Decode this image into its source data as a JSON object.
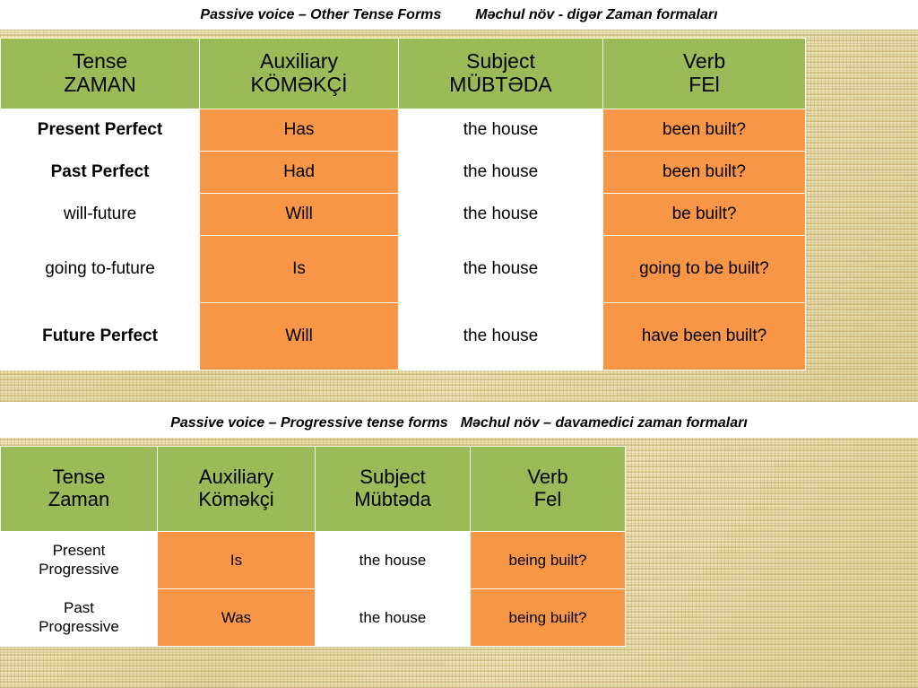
{
  "slide": {
    "section1": {
      "caption_en": "Passive voice – Other Tense Forms",
      "caption_az": "Məchul növ - digər Zaman formaları",
      "headers": [
        {
          "en": "Tense",
          "az": "ZAMAN"
        },
        {
          "en": "Auxiliary",
          "az": "KÖMƏKÇİ"
        },
        {
          "en": "Subject",
          "az": "MÜBTƏDA"
        },
        {
          "en": "Verb",
          "az": "FEl"
        }
      ],
      "rows": [
        {
          "tense": "Present Perfect",
          "aux": "Has",
          "subject": "the house",
          "verb": "been built?"
        },
        {
          "tense": "Past Perfect",
          "aux": "Had",
          "subject": "the house",
          "verb": "been built?"
        },
        {
          "tense": "will-future",
          "aux": "Will",
          "subject": "the house",
          "verb": "be built?"
        },
        {
          "tense": "going to-future",
          "aux": "Is",
          "subject": "the house",
          "verb": "going to be built?"
        },
        {
          "tense": "Future Perfect",
          "aux": "Will",
          "subject": "the house",
          "verb": "have been built?"
        }
      ]
    },
    "section2": {
      "caption_en": "Passive voice – Progressive tense forms",
      "caption_az": "Məchul növ – davamedici zaman formaları",
      "headers": [
        {
          "en": "Tense",
          "az": "Zaman"
        },
        {
          "en": "Auxiliary",
          "az": "Köməkçi"
        },
        {
          "en": "Subject",
          "az": "Mübtəda"
        },
        {
          "en": "Verb",
          "az": "Fel"
        }
      ],
      "rows": [
        {
          "tense_l1": "Present",
          "tense_l2": "Progressive",
          "aux": "Is",
          "subject": "the house",
          "verb": "being built?"
        },
        {
          "tense_l1": "Past",
          "tense_l2": "Progressive",
          "aux": "Was",
          "subject": "the house",
          "verb": "being built?"
        }
      ]
    },
    "colors": {
      "header_green": "#9bbb59",
      "cell_orange": "#f79646",
      "cell_white": "#ffffff",
      "paper": "#e8d9a0"
    }
  }
}
